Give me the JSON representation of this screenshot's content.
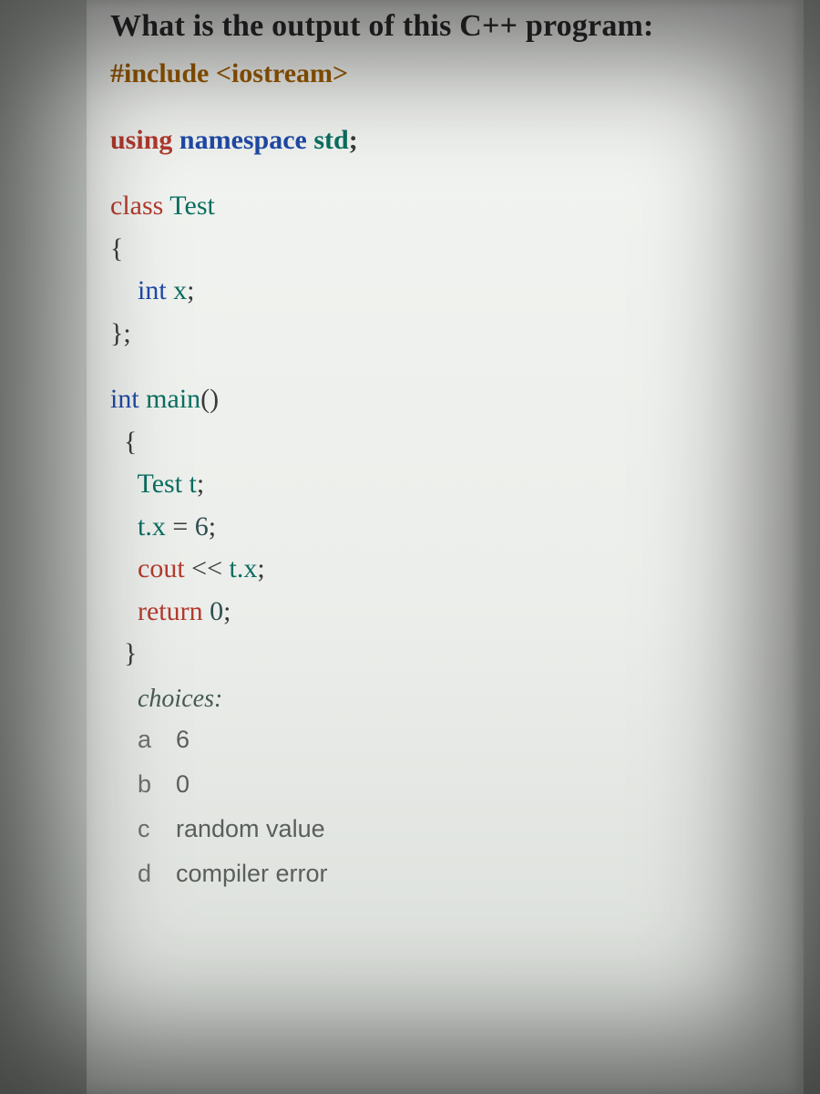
{
  "question": "What is the output of this C++ program:",
  "code": {
    "l1a": "#include ",
    "l1b": "<iostream>",
    "l2a": "using ",
    "l2b": "namespace ",
    "l2c": "std",
    "l2d": ";",
    "l3a": "class ",
    "l3b": "Test",
    "l4": "{",
    "l5a": "int ",
    "l5b": "x",
    "l5c": ";",
    "l6": "};",
    "l7a": "int ",
    "l7b": "main",
    "l7c": "()",
    "l8": "{",
    "l9a": "Test ",
    "l9b": "t",
    "l9c": ";",
    "l10a": "t.x ",
    "l10b": "= ",
    "l10c": "6",
    "l10d": ";",
    "l11a": "cout ",
    "l11b": "<< ",
    "l11c": "t.x",
    "l11d": ";",
    "l12a": "return ",
    "l12b": "0",
    "l12c": ";",
    "l13": "}"
  },
  "choices_label": "choices:",
  "choices": [
    {
      "letter": "a",
      "text": "6"
    },
    {
      "letter": "b",
      "text": "0"
    },
    {
      "letter": "c",
      "text": "random value"
    },
    {
      "letter": "d",
      "text": "compiler error"
    }
  ]
}
